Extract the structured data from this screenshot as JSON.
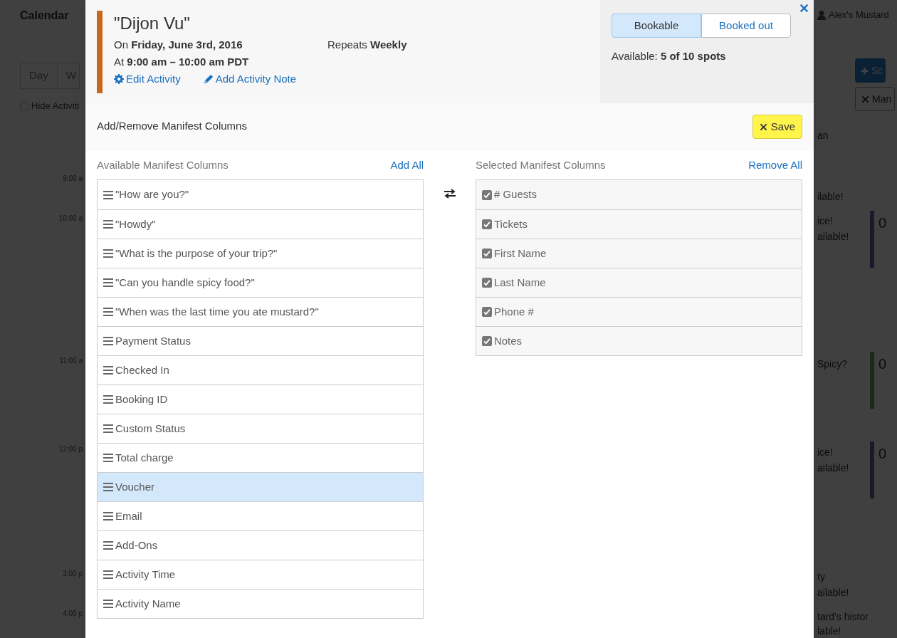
{
  "background": {
    "title": "Calendar",
    "user": "Alex's Mustard",
    "view_tabs": [
      {
        "label": "Day"
      },
      {
        "label": "W"
      }
    ],
    "hide_checkbox": {
      "label": "Hide Activiti",
      "checked": false
    },
    "times": [
      "9:00 a",
      "10:00 a",
      "11:00 a",
      "12:00 p",
      "3:00 p",
      "4:00 p"
    ],
    "buttons": [
      {
        "label": "Sc"
      },
      {
        "label": "Man"
      }
    ],
    "fragments": [
      "an",
      "ilable!",
      "ice!",
      "ailable!",
      "Spicy?",
      "ice!",
      "ailable!",
      "ty",
      "ailable!",
      "tard's histor",
      "lable!"
    ],
    "counts": [
      "0",
      "0",
      "0"
    ]
  },
  "modal": {
    "title": "\"Dijon Vu\"",
    "date_line": "On **Friday, June 3rd, 2016**",
    "time_line": "At **9:00 am – 10:00 am PDT**",
    "repeats": "Repeats **Weekly**",
    "links": [
      {
        "label": "Edit Activity"
      },
      {
        "label": "Add Activity Note"
      }
    ],
    "availability_toggle": [
      {
        "label": "Bookable",
        "selected": true
      },
      {
        "label": "Booked out",
        "selected": false
      }
    ],
    "availability": "Available: **5 of 10 spots**",
    "section_title": "Add/Remove Manifest Columns",
    "save": "Save",
    "available": {
      "heading": "Available Manifest Columns",
      "action": "Add All",
      "items": [
        {
          "label": "\"How are you?\"",
          "selected": false
        },
        {
          "label": "\"Howdy\"",
          "selected": false
        },
        {
          "label": "\"What is the purpose of your trip?\"",
          "selected": false
        },
        {
          "label": "\"Can you handle spicy food?\"",
          "selected": false
        },
        {
          "label": "\"When was the last time you ate mustard?\"",
          "selected": false
        },
        {
          "label": "Payment Status",
          "selected": false
        },
        {
          "label": "Checked In",
          "selected": false
        },
        {
          "label": "Booking ID",
          "selected": false
        },
        {
          "label": "Custom Status",
          "selected": false
        },
        {
          "label": "Total charge",
          "selected": false
        },
        {
          "label": "Voucher",
          "selected": true
        },
        {
          "label": "Email",
          "selected": false
        },
        {
          "label": "Add-Ons",
          "selected": false
        },
        {
          "label": "Activity Time",
          "selected": false
        },
        {
          "label": "Activity Name",
          "selected": false
        }
      ]
    },
    "selected": {
      "heading": "Selected Manifest Columns",
      "action": "Remove All",
      "items": [
        {
          "label": "# Guests",
          "checked": true
        },
        {
          "label": "Tickets",
          "checked": true
        },
        {
          "label": "First Name",
          "checked": true
        },
        {
          "label": "Last Name",
          "checked": true
        },
        {
          "label": "Phone #",
          "checked": true
        },
        {
          "label": "Notes",
          "checked": true
        }
      ]
    }
  }
}
